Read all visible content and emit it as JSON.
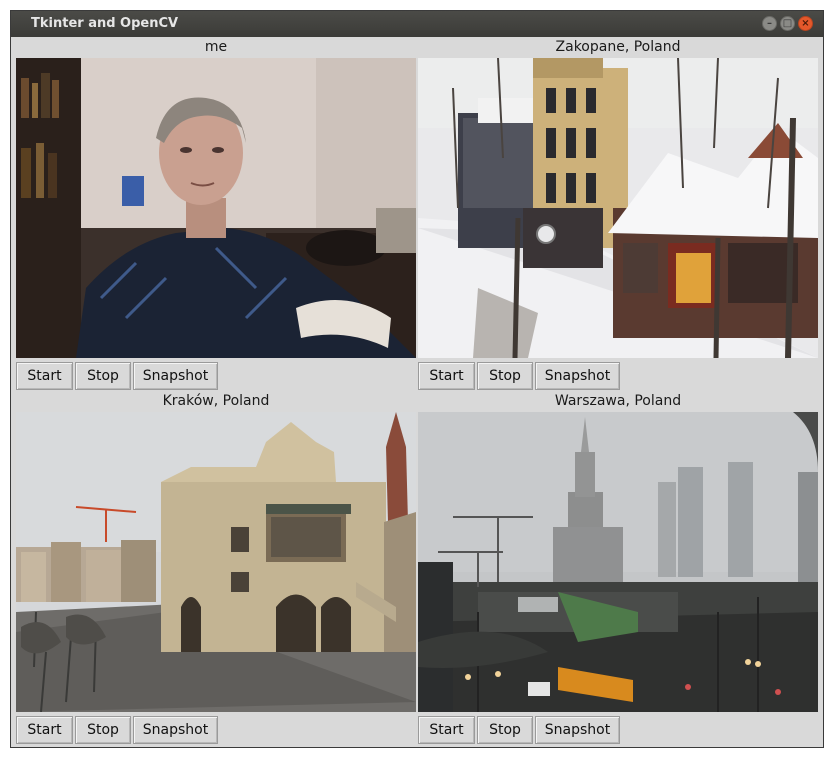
{
  "window": {
    "title": "Tkinter and OpenCV"
  },
  "panes": [
    {
      "title": "me",
      "start_label": "Start",
      "stop_label": "Stop",
      "snapshot_label": "Snapshot"
    },
    {
      "title": "Zakopane, Poland",
      "start_label": "Start",
      "stop_label": "Stop",
      "snapshot_label": "Snapshot"
    },
    {
      "title": "Kraków, Poland",
      "start_label": "Start",
      "stop_label": "Stop",
      "snapshot_label": "Snapshot"
    },
    {
      "title": "Warszawa, Poland",
      "start_label": "Start",
      "stop_label": "Stop",
      "snapshot_label": "Snapshot"
    }
  ],
  "icons": {
    "minimize": "minimize-icon",
    "maximize": "maximize-icon",
    "close": "close-icon"
  }
}
